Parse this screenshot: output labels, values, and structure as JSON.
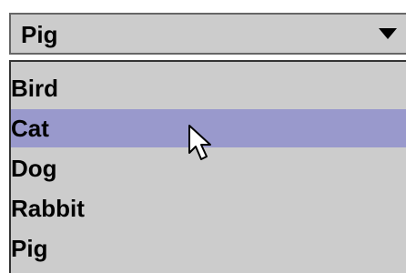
{
  "combo": {
    "selected_value": "Pig",
    "arrow_icon": "triangle-down-icon"
  },
  "list": {
    "items": [
      {
        "label": "Bird",
        "selected": false
      },
      {
        "label": "Cat",
        "selected": true
      },
      {
        "label": "Dog",
        "selected": false
      },
      {
        "label": "Rabbit",
        "selected": false
      },
      {
        "label": "Pig",
        "selected": false
      }
    ]
  },
  "colors": {
    "background": "#cccccc",
    "highlight": "#9999cc",
    "text": "#000000"
  },
  "cursor_icon": "mouse-pointer-icon"
}
